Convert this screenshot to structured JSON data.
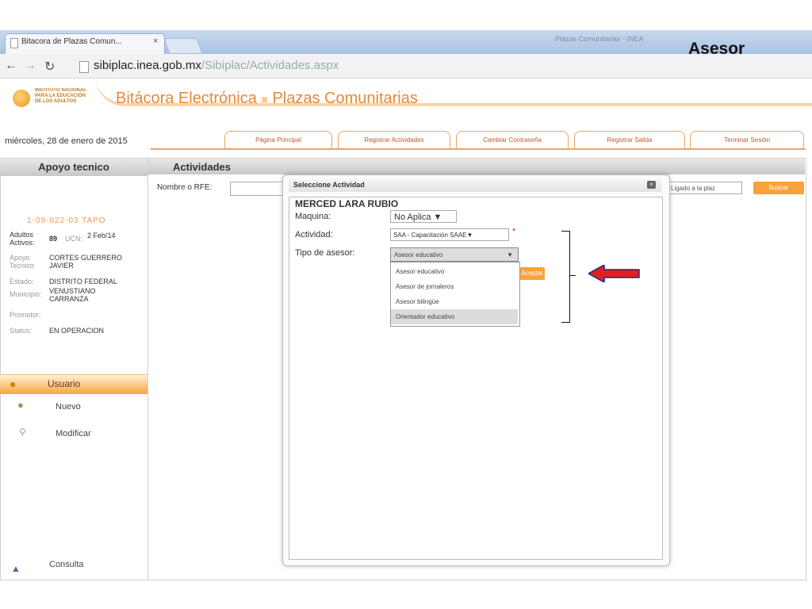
{
  "browser": {
    "tab_title": "Bitacora de Plazas Comun...",
    "tab_close": "×",
    "url_host": "sibiplac.inea.gob.mx",
    "url_path": "/Sibiplac/Actividades.aspx",
    "window_title": "Plazas Comunitarias - INEA"
  },
  "annotation": {
    "label": "Asesor",
    "arrow_color": "#e02020"
  },
  "header": {
    "logo_text": "INSTITUTO NACIONAL PARA LA EDUCACIÓN DE LOS ADULTOS",
    "title_part1": "Bitácora Electrónica",
    "title_sep": "■",
    "title_part2": "Plazas Comunitarias",
    "date": "miércoles, 28 de enero de 2015"
  },
  "nav": [
    "Página Principal",
    "Registrar Actividades",
    "Cambiar Contraseña",
    "Registrar Salida",
    "Terminar Sesión"
  ],
  "sidebar": {
    "heading": "Apoyo tecnico",
    "code": "1-09-022-03 TAPO",
    "adultos_label": "Adultos Activos:",
    "adultos_value": "89",
    "ucn_label": "UCN:",
    "ucn_value": "2 Feb/14",
    "apoyo_label": "Apoyo Tecnico:",
    "apoyo_value": "CORTES GUERRERO JAVIER",
    "estado_label": "Estado:",
    "estado_value": "DISTRITO FEDERAL",
    "municipio_label": "Municipio:",
    "municipio_value": "VENUSTIANO CARRANZA",
    "promotor_label": "Promotor:",
    "promotor_value": "",
    "status_label": "Status:",
    "status_value": "EN OPERACION",
    "menu_usuario": "Usuario",
    "menu_nuevo": "Nuevo",
    "menu_modificar": "Modificar",
    "menu_consulta": "Consulta"
  },
  "main": {
    "title": "Actividades",
    "rfe_label": "Nombre o RFE:",
    "ligado_select": "Ligado a la plaz",
    "buscar": "Buscar"
  },
  "modal": {
    "title": "Seleccione Actividad",
    "close": "×",
    "student": "MERCED LARA RUBIO",
    "maquina_label": "Maquina:",
    "maquina_value": "No Aplica",
    "actividad_label": "Actividad:",
    "actividad_value": "SAA - Capacitación SAAE",
    "required": "*",
    "tipo_label": "Tipo de asesor:",
    "tipo_value": "Asesor educativo",
    "options": [
      "Asesor educativo",
      "Asesor de jornaleros",
      "Asesor bilingüe",
      "Orientador educativo"
    ],
    "button_behind": "Aceptar"
  },
  "icons": [
    "back-icon",
    "forward-icon",
    "reload-icon",
    "page-icon",
    "logo-icon",
    "user-icon",
    "add-user-icon",
    "search-icon",
    "consulta-icon",
    "close-icon",
    "red-arrow-icon"
  ]
}
